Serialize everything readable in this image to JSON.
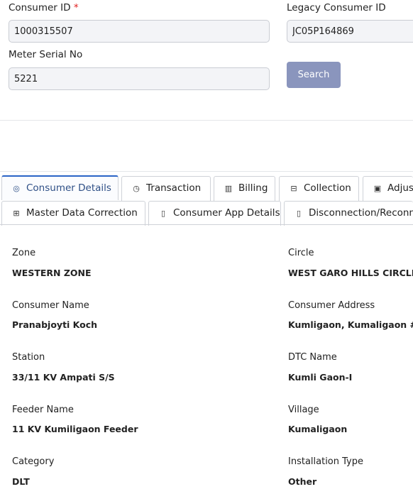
{
  "search_form": {
    "consumer_id": {
      "label": "Consumer ID",
      "required_mark": "*",
      "value": "1000315507"
    },
    "legacy_consumer_id": {
      "label": "Legacy Consumer ID",
      "value": "JC05P164869"
    },
    "meter_serial_no": {
      "label": "Meter Serial No",
      "value": "5221"
    },
    "search_button": "Search"
  },
  "tabs": {
    "consumer_details": {
      "label": "Consumer Details",
      "icon": "record-icon",
      "active": true
    },
    "transaction": {
      "label": "Transaction",
      "icon": "clock-icon"
    },
    "billing": {
      "label": "Billing",
      "icon": "bar-chart-icon"
    },
    "collection": {
      "label": "Collection",
      "icon": "receipt-icon"
    },
    "adjustment": {
      "label": "Adjus",
      "icon": "image-icon"
    },
    "master_data_correction": {
      "label": "Master Data Correction",
      "icon": "plus-box-icon"
    },
    "consumer_app_details": {
      "label": "Consumer App Details",
      "icon": "mobile-icon"
    },
    "disconnection": {
      "label": "Disconnection/Reconne",
      "icon": "mobile-icon"
    }
  },
  "details": {
    "zone": {
      "label": "Zone",
      "value": "WESTERN ZONE"
    },
    "circle": {
      "label": "Circle",
      "value": "WEST GARO HILLS CIRCLE"
    },
    "consumer_name": {
      "label": "Consumer Name",
      "value": "Pranabjoyti Koch"
    },
    "consumer_address": {
      "label": "Consumer Address",
      "value": "Kumligaon, Kumaligaon #"
    },
    "station": {
      "label": "Station",
      "value": "33/11 KV Ampati S/S"
    },
    "dtc_name": {
      "label": "DTC Name",
      "value": "Kumli Gaon-I"
    },
    "feeder_name": {
      "label": "Feeder Name",
      "value": "11 KV Kumiligaon Feeder"
    },
    "village": {
      "label": "Village",
      "value": "Kumaligaon"
    },
    "category": {
      "label": "Category",
      "value": "DLT"
    },
    "installation_type": {
      "label": "Installation Type",
      "value": "Other"
    }
  },
  "colors": {
    "accent": "#2a63c6",
    "button": "#8a95bd",
    "input_bg": "#f3f4f7"
  }
}
